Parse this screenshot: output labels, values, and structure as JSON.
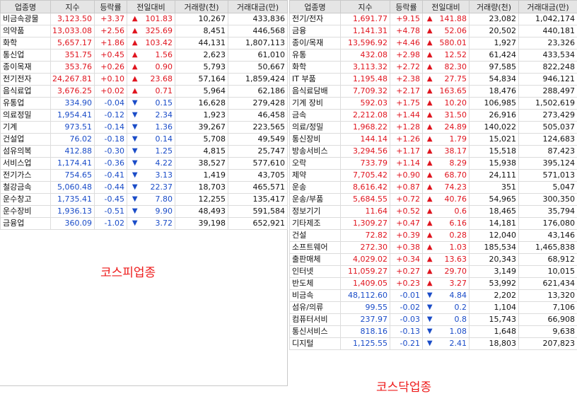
{
  "headers": [
    "업종명",
    "지수",
    "등락률",
    "전일대비",
    "거래량(천)",
    "거래대금(만)"
  ],
  "colors": {
    "up": "#e0141e",
    "down": "#1a4cc8",
    "caption": "#ee1c1c"
  },
  "kospi": {
    "caption": "코스피업종",
    "rows": [
      {
        "name": "비금속광물",
        "index": "3,123.50",
        "rate": "+3.37",
        "dir": "up",
        "diff": "101.83",
        "vol": "10,267",
        "amt": "433,836"
      },
      {
        "name": "의약품",
        "index": "13,033.08",
        "rate": "+2.56",
        "dir": "up",
        "diff": "325.69",
        "vol": "8,451",
        "amt": "446,568"
      },
      {
        "name": "화학",
        "index": "5,657.17",
        "rate": "+1.86",
        "dir": "up",
        "diff": "103.42",
        "vol": "44,131",
        "amt": "1,807,113"
      },
      {
        "name": "통신업",
        "index": "351.75",
        "rate": "+0.45",
        "dir": "up",
        "diff": "1.56",
        "vol": "2,623",
        "amt": "61,010"
      },
      {
        "name": "종이목재",
        "index": "353.76",
        "rate": "+0.26",
        "dir": "up",
        "diff": "0.90",
        "vol": "5,793",
        "amt": "50,667"
      },
      {
        "name": "전기전자",
        "index": "24,267.81",
        "rate": "+0.10",
        "dir": "up",
        "diff": "23.68",
        "vol": "57,164",
        "amt": "1,859,424"
      },
      {
        "name": "음식료업",
        "index": "3,676.25",
        "rate": "+0.02",
        "dir": "up",
        "diff": "0.71",
        "vol": "5,964",
        "amt": "62,186"
      },
      {
        "name": "유통업",
        "index": "334.90",
        "rate": "-0.04",
        "dir": "down",
        "diff": "0.15",
        "vol": "16,628",
        "amt": "279,428"
      },
      {
        "name": "의료정밀",
        "index": "1,954.41",
        "rate": "-0.12",
        "dir": "down",
        "diff": "2.34",
        "vol": "1,923",
        "amt": "46,458"
      },
      {
        "name": "기계",
        "index": "973.51",
        "rate": "-0.14",
        "dir": "down",
        "diff": "1.36",
        "vol": "39,267",
        "amt": "223,565"
      },
      {
        "name": "건설업",
        "index": "76.02",
        "rate": "-0.18",
        "dir": "down",
        "diff": "0.14",
        "vol": "5,708",
        "amt": "49,549"
      },
      {
        "name": "섬유의복",
        "index": "412.88",
        "rate": "-0.30",
        "dir": "down",
        "diff": "1.25",
        "vol": "4,815",
        "amt": "25,747"
      },
      {
        "name": "서비스업",
        "index": "1,174.41",
        "rate": "-0.36",
        "dir": "down",
        "diff": "4.22",
        "vol": "38,527",
        "amt": "577,610"
      },
      {
        "name": "전기가스",
        "index": "754.65",
        "rate": "-0.41",
        "dir": "down",
        "diff": "3.13",
        "vol": "1,419",
        "amt": "43,705"
      },
      {
        "name": "철강금속",
        "index": "5,060.48",
        "rate": "-0.44",
        "dir": "down",
        "diff": "22.37",
        "vol": "18,703",
        "amt": "465,571"
      },
      {
        "name": "운수창고",
        "index": "1,735.41",
        "rate": "-0.45",
        "dir": "down",
        "diff": "7.80",
        "vol": "12,255",
        "amt": "135,417"
      },
      {
        "name": "운수장비",
        "index": "1,936.13",
        "rate": "-0.51",
        "dir": "down",
        "diff": "9.90",
        "vol": "48,493",
        "amt": "591,584"
      },
      {
        "name": "금융업",
        "index": "360.09",
        "rate": "-1.02",
        "dir": "down",
        "diff": "3.72",
        "vol": "39,198",
        "amt": "652,921"
      }
    ]
  },
  "kosdaq": {
    "caption": "코스닥업종",
    "rows": [
      {
        "name": "전기/전자",
        "index": "1,691.77",
        "rate": "+9.15",
        "dir": "up",
        "diff": "141.88",
        "vol": "23,082",
        "amt": "1,042,174"
      },
      {
        "name": "금융",
        "index": "1,141.31",
        "rate": "+4.78",
        "dir": "up",
        "diff": "52.06",
        "vol": "20,502",
        "amt": "440,181"
      },
      {
        "name": "종이/목재",
        "index": "13,596.92",
        "rate": "+4.46",
        "dir": "up",
        "diff": "580.01",
        "vol": "1,927",
        "amt": "23,326"
      },
      {
        "name": "유통",
        "index": "432.08",
        "rate": "+2.98",
        "dir": "up",
        "diff": "12.52",
        "vol": "61,424",
        "amt": "433,534"
      },
      {
        "name": "화학",
        "index": "3,113.32",
        "rate": "+2.72",
        "dir": "up",
        "diff": "82.30",
        "vol": "97,585",
        "amt": "822,248"
      },
      {
        "name": "IT 부품",
        "index": "1,195.48",
        "rate": "+2.38",
        "dir": "up",
        "diff": "27.75",
        "vol": "54,834",
        "amt": "946,121"
      },
      {
        "name": "음식료담배",
        "index": "7,709.32",
        "rate": "+2.17",
        "dir": "up",
        "diff": "163.65",
        "vol": "18,476",
        "amt": "288,497"
      },
      {
        "name": "기계 장비",
        "index": "592.03",
        "rate": "+1.75",
        "dir": "up",
        "diff": "10.20",
        "vol": "106,985",
        "amt": "1,502,619"
      },
      {
        "name": "금속",
        "index": "2,212.08",
        "rate": "+1.44",
        "dir": "up",
        "diff": "31.50",
        "vol": "26,916",
        "amt": "273,429"
      },
      {
        "name": "의료/정밀",
        "index": "1,968.22",
        "rate": "+1.28",
        "dir": "up",
        "diff": "24.89",
        "vol": "140,022",
        "amt": "505,037"
      },
      {
        "name": "통신장비",
        "index": "144.14",
        "rate": "+1.26",
        "dir": "up",
        "diff": "1.79",
        "vol": "15,021",
        "amt": "124,683"
      },
      {
        "name": "방송서비스",
        "index": "3,294.56",
        "rate": "+1.17",
        "dir": "up",
        "diff": "38.17",
        "vol": "15,518",
        "amt": "87,423"
      },
      {
        "name": "오락",
        "index": "733.79",
        "rate": "+1.14",
        "dir": "up",
        "diff": "8.29",
        "vol": "15,938",
        "amt": "395,124"
      },
      {
        "name": "제약",
        "index": "7,705.42",
        "rate": "+0.90",
        "dir": "up",
        "diff": "68.70",
        "vol": "24,111",
        "amt": "571,013"
      },
      {
        "name": "운송",
        "index": "8,616.42",
        "rate": "+0.87",
        "dir": "up",
        "diff": "74.23",
        "vol": "351",
        "amt": "5,047"
      },
      {
        "name": "운송/부품",
        "index": "5,684.55",
        "rate": "+0.72",
        "dir": "up",
        "diff": "40.76",
        "vol": "54,965",
        "amt": "300,350"
      },
      {
        "name": "정보기기",
        "index": "11.64",
        "rate": "+0.52",
        "dir": "up",
        "diff": "0.6",
        "vol": "18,465",
        "amt": "35,794"
      },
      {
        "name": "기타제조",
        "index": "1,309.27",
        "rate": "+0.47",
        "dir": "up",
        "diff": "6.16",
        "vol": "14,181",
        "amt": "176,080"
      },
      {
        "name": "건설",
        "index": "72.82",
        "rate": "+0.39",
        "dir": "up",
        "diff": "0.28",
        "vol": "12,040",
        "amt": "43,146"
      },
      {
        "name": "소프트웨어",
        "index": "272.30",
        "rate": "+0.38",
        "dir": "up",
        "diff": "1.03",
        "vol": "185,534",
        "amt": "1,465,838"
      },
      {
        "name": "출판매체",
        "index": "4,029.02",
        "rate": "+0.34",
        "dir": "up",
        "diff": "13.63",
        "vol": "20,343",
        "amt": "68,912"
      },
      {
        "name": "인터넷",
        "index": "11,059.27",
        "rate": "+0.27",
        "dir": "up",
        "diff": "29.70",
        "vol": "3,149",
        "amt": "10,015"
      },
      {
        "name": "반도체",
        "index": "1,409.05",
        "rate": "+0.23",
        "dir": "up",
        "diff": "3.27",
        "vol": "53,992",
        "amt": "621,434"
      },
      {
        "name": "비금속",
        "index": "48,112.60",
        "rate": "-0.01",
        "dir": "down",
        "diff": "4.84",
        "vol": "2,202",
        "amt": "13,320"
      },
      {
        "name": "섬유/의류",
        "index": "99.55",
        "rate": "-0.02",
        "dir": "down",
        "diff": "0.2",
        "vol": "1,104",
        "amt": "7,106"
      },
      {
        "name": "컴퓨터서비",
        "index": "237.97",
        "rate": "-0.03",
        "dir": "down",
        "diff": "0.8",
        "vol": "15,743",
        "amt": "66,908"
      },
      {
        "name": "통신서비스",
        "index": "818.16",
        "rate": "-0.13",
        "dir": "down",
        "diff": "1.08",
        "vol": "1,648",
        "amt": "9,638"
      },
      {
        "name": "디지털",
        "index": "1,125.55",
        "rate": "-0.21",
        "dir": "down",
        "diff": "2.41",
        "vol": "18,803",
        "amt": "207,823"
      }
    ]
  }
}
